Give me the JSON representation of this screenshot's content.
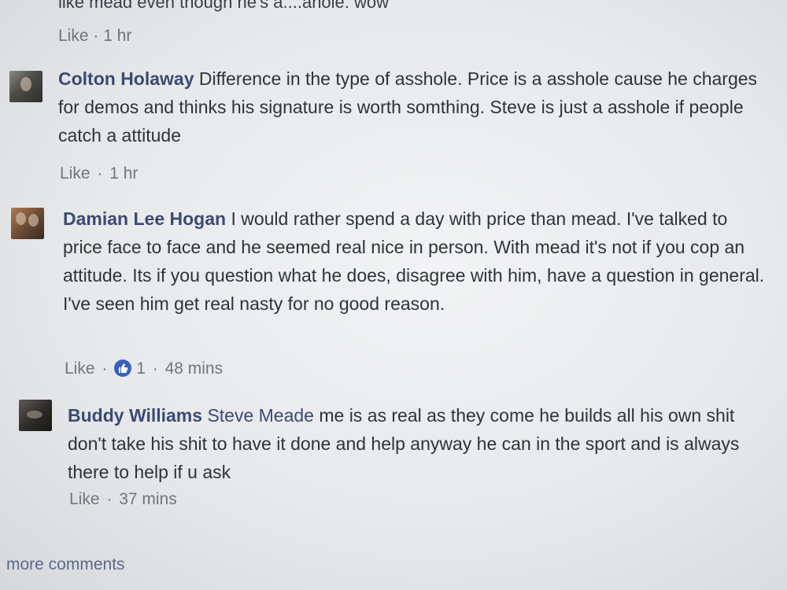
{
  "top": {
    "fragment": "like mead even though he's a....anole. wow",
    "like_label": "Like",
    "time": "1 hr"
  },
  "comments": [
    {
      "author": "Colton Holaway",
      "body": "Difference in the type of asshole. Price is a asshole cause he charges for demos and thinks his signature is worth somthing. Steve is just a asshole if people catch a attitude",
      "like_label": "Like",
      "time": "1 hr"
    },
    {
      "author": "Damian Lee Hogan",
      "body": "I would rather spend a day with price than mead. I've talked to price face to face and he seemed real nice in person. With mead it's not if you cop an attitude. Its if you question what he does, disagree with him, have a question in general. I've seen him get real nasty for no good reason.",
      "like_label": "Like",
      "reactions": "1",
      "time": "48 mins"
    },
    {
      "author": "Buddy Williams",
      "mention": "Steve Meade",
      "body": "me is as real as they come he builds all his own shit don't take his shit to have it done and help anyway he can in the sport and is always there to help if u ask",
      "like_label": "Like",
      "time": "37 mins"
    }
  ],
  "more_comments": "more comments",
  "colors": {
    "author": "#3b4a73",
    "like_reaction": "#3b5fbf"
  },
  "icons": {
    "reaction": "thumbs-up-icon"
  }
}
